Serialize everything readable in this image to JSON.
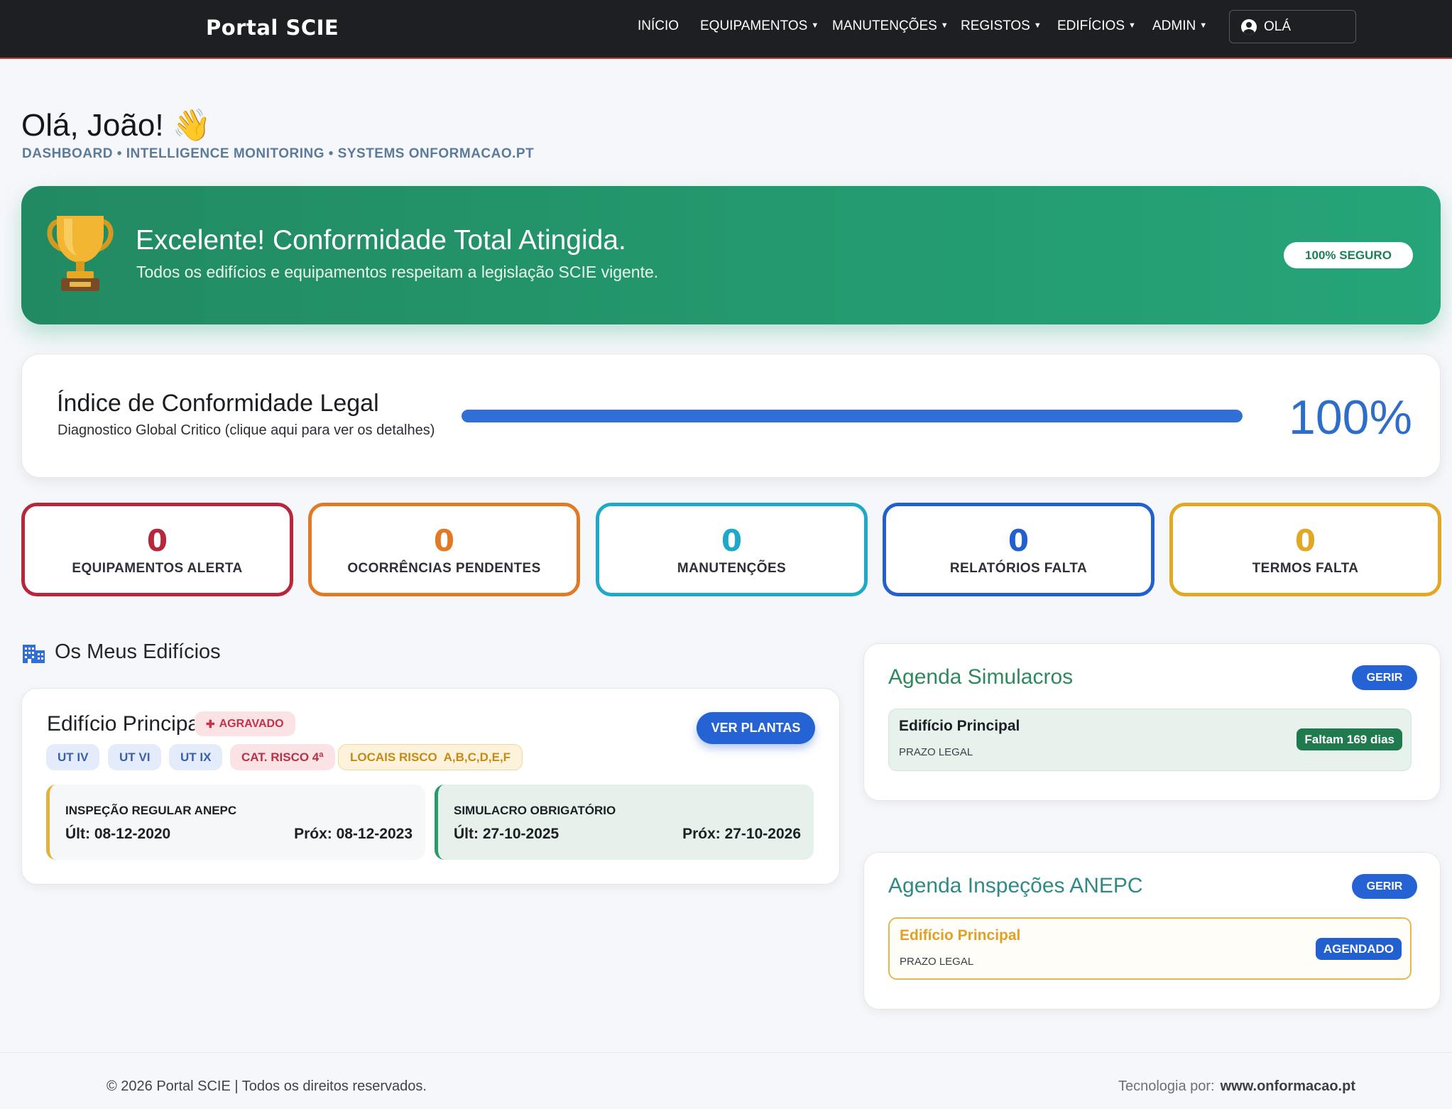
{
  "navbar": {
    "brand": "Portal SCIE",
    "items": [
      {
        "label": "INÍCIO",
        "dropdown": false
      },
      {
        "label": "EQUIPAMENTOS",
        "dropdown": true
      },
      {
        "label": "MANUTENÇÕES",
        "dropdown": true
      },
      {
        "label": "REGISTOS",
        "dropdown": true
      },
      {
        "label": "EDIFÍCIOS",
        "dropdown": true
      },
      {
        "label": "ADMIN",
        "dropdown": true
      }
    ],
    "user_label": "OLÁ",
    "user_icon": "user-circle-icon"
  },
  "greeting": {
    "title": "Olá, João!",
    "emoji": "👋",
    "subtitle": "DASHBOARD • INTELLIGENCE MONITORING • SYSTEMS ONFORMACAO.PT"
  },
  "hero": {
    "icon": "trophy-icon",
    "title": "Excelente! Conformidade Total Atingida.",
    "text": "Todos os edifícios e equipamentos respeitam a legislação SCIE vigente.",
    "pill": "100% SEGURO",
    "colors": {
      "from": "#228a62",
      "to": "#25a579"
    }
  },
  "index": {
    "title": "Índice de Conformidade Legal",
    "description": "Diagnostico Global Critico (clique aqui para ver os detalhes)",
    "value_text": "100%",
    "progress": 1.0,
    "accent": "#2f6fd6"
  },
  "stats": [
    {
      "value": "0",
      "label": "EQUIPAMENTOS ALERTA",
      "color": "#b8263b"
    },
    {
      "value": "0",
      "label": "OCORRÊNCIAS PENDENTES",
      "color": "#e07a26"
    },
    {
      "value": "0",
      "label": "MANUTENÇÕES",
      "color": "#1fa9c8"
    },
    {
      "value": "0",
      "label": "RELATÓRIOS FALTA",
      "color": "#2360cf"
    },
    {
      "value": "0",
      "label": "TERMOS FALTA",
      "color": "#e3a823"
    }
  ],
  "buildings": {
    "section_title": "Os Meus Edifícios",
    "section_icon": "building-icon",
    "card": {
      "name": "Edifício Principal",
      "status_badge": "AGRAVADO",
      "status_icon": "alert-icon",
      "action_button": "VER PLANTAS",
      "chips": [
        {
          "label": "UT IV",
          "style": "blue"
        },
        {
          "label": "UT VI",
          "style": "blue"
        },
        {
          "label": "UT IX",
          "style": "blue"
        },
        {
          "label": "CAT. RISCO 4ª",
          "style": "red"
        },
        {
          "label": "LOCAIS RISCO  A,B,C,D,E,F",
          "style": "yellow"
        }
      ],
      "boxes": [
        {
          "title": "INSPEÇÃO REGULAR ANEPC",
          "ult": "Últ: 08-12-2020",
          "prox": "Próx: 08-12-2023",
          "accent": "#e3b23c",
          "bg": "#f6f7f9"
        },
        {
          "title": "SIMULACRO OBRIGATÓRIO",
          "ult": "Últ: 27-10-2025",
          "prox": "Próx: 27-10-2026",
          "accent": "#2a9a6c",
          "bg": "#e6f1ec"
        }
      ]
    }
  },
  "agendas": [
    {
      "title": "Agenda Simulacros",
      "title_color": "#2e8a5e",
      "manage_button": "GERIR",
      "row": {
        "name": "Edifício Principal",
        "sub": "PRAZO LEGAL",
        "badge": "Faltam 169 dias",
        "badge_color": "#1f7a4e",
        "name_color": "#1c1f24",
        "bg": "#e8f2ec",
        "border": "#d3e6da"
      }
    },
    {
      "title": "Agenda Inspeções ANEPC",
      "title_color": "#2f8a86",
      "manage_button": "GERIR",
      "row": {
        "name": "Edifício Principal",
        "sub": "PRAZO LEGAL",
        "badge": "AGENDADO",
        "badge_color": "#2360cf",
        "name_color": "#e0a126",
        "bg": "#fffdf7",
        "border": "#e3b94f"
      }
    }
  ],
  "footer": {
    "copyright": "© 2026 Portal SCIE | Todos os direitos reservados.",
    "tech_label": "Tecnologia por:",
    "tech_link": "www.onformacao.pt"
  }
}
